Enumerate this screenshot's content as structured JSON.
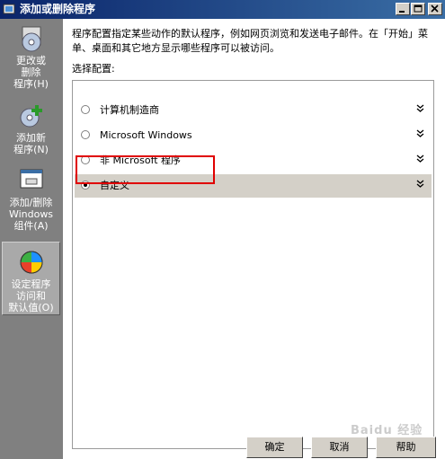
{
  "window": {
    "title": "添加或删除程序"
  },
  "sidebar": {
    "items": [
      {
        "label": "更改或\n删除\n程序(H)",
        "icon": "programs-cd-icon"
      },
      {
        "label": "添加新\n程序(N)",
        "icon": "add-programs-icon"
      },
      {
        "label": "添加/删除\nWindows\n组件(A)",
        "icon": "windows-components-icon"
      },
      {
        "label": "设定程序\n访问和\n默认值(O)",
        "icon": "defaults-globe-icon",
        "selected": true
      }
    ]
  },
  "main": {
    "description": "程序配置指定某些动作的默认程序，例如网页浏览和发送电子邮件。在「开始」菜单、桌面和其它地方显示哪些程序可以被访问。",
    "choose_label": "选择配置:",
    "options": [
      {
        "label": "计算机制造商",
        "selected": false
      },
      {
        "label": "Microsoft Windows",
        "selected": false
      },
      {
        "label": "非 Microsoft 程序",
        "selected": false
      },
      {
        "label": "自定义",
        "selected": true
      }
    ]
  },
  "buttons": {
    "ok": "确定",
    "cancel": "取消",
    "help": "帮助"
  },
  "watermark": "Baidu 经验",
  "colors": {
    "titlebar_start": "#0a246a",
    "titlebar_end": "#3a6ea5",
    "sidebar": "#808080",
    "highlight_box": "#e00000"
  }
}
